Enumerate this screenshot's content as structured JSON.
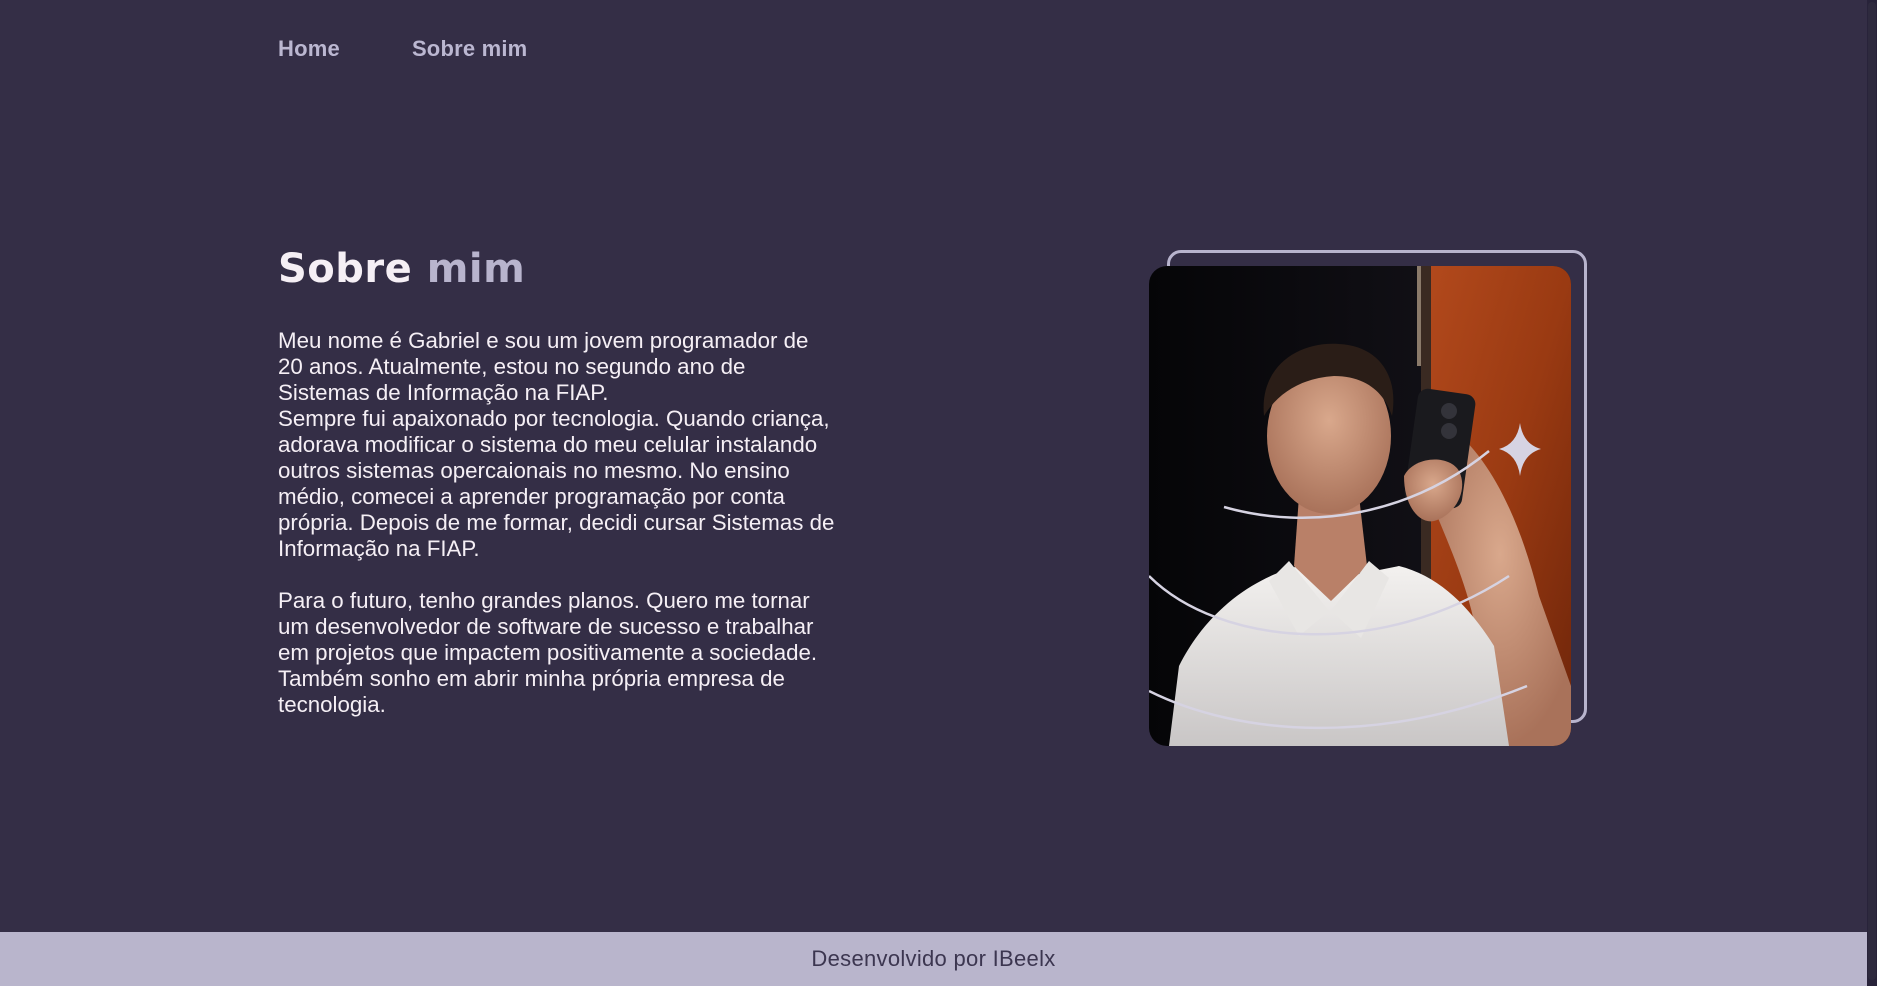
{
  "nav": {
    "items": [
      {
        "label": "Home"
      },
      {
        "label": "Sobre mim"
      }
    ]
  },
  "hero": {
    "title_part1": "Sobre",
    "title_part2": "mim",
    "bio_para1": "Meu nome é Gabriel e sou um jovem programador de 20 anos. Atualmente, estou no segundo ano de Sistemas de Informação na FIAP.",
    "bio_para2": "Sempre fui apaixonado por tecnologia. Quando criança, adorava modificar o sistema do meu celular instalando outros sistemas opercaionais no mesmo. No ensino médio, comecei a aprender programação por conta própria. Depois de me formar, decidi cursar Sistemas de Informação na FIAP.",
    "bio_para3": "Para o futuro, tenho grandes planos. Quero me tornar um desenvolvedor de software de sucesso e trabalhar em projetos que impactem positivamente a sociedade. Também sonho em abrir minha própria empresa de tecnologia."
  },
  "footer": {
    "credit": "Desenvolvido por IBeelx"
  },
  "colors": {
    "background": "#342e46",
    "accent": "#b8b4cd",
    "text": "#f5eff5",
    "footer_bg": "#b9b5cc"
  }
}
